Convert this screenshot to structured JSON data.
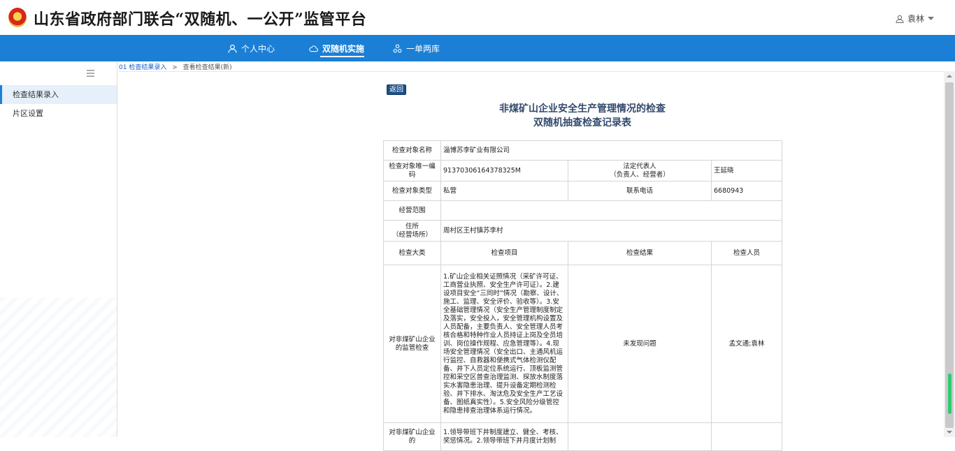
{
  "app": {
    "title": "山东省政府部门联合“双随机、一公开”监管平台",
    "user": "袁林"
  },
  "nav": {
    "items": [
      {
        "label": "个人中心",
        "icon": "user-icon"
      },
      {
        "label": "双随机实施",
        "icon": "cloud-icon",
        "active": true
      },
      {
        "label": "一单两库",
        "icon": "cluster-icon"
      }
    ]
  },
  "sidebar": {
    "items": [
      {
        "label": "检查结果录入",
        "active": true
      },
      {
        "label": "片区设置"
      }
    ]
  },
  "breadcrumb": {
    "link": "01 检查结果录入",
    "sep": ">",
    "current": "查看检查结果(新)"
  },
  "page": {
    "back_label": "返回",
    "title_line1": "非煤矿山企业安全生产管理情况的检查",
    "title_line2": "双随机抽查检查记录表"
  },
  "record": {
    "name_label": "检查对象名称",
    "name_value": "淄博苏李矿业有限公司",
    "code_label": "检查对象唯一编码",
    "code_value": "91370306164378325M",
    "legal_label_1": "法定代表人",
    "legal_label_2": "（负责人、经营者）",
    "legal_value": "王延晓",
    "type_label": "检查对象类型",
    "type_value": "私营",
    "phone_label": "联系电话",
    "phone_value": "6680943",
    "scope_label": "经营范围",
    "scope_value": "",
    "addr_label_1": "住所",
    "addr_label_2": "（经营场所）",
    "addr_value": "周村区王村镇苏李村"
  },
  "table": {
    "headers": [
      "检查大类",
      "检查项目",
      "检查结果",
      "检查人员"
    ],
    "rows": [
      {
        "category": "对非煤矿山企业的监管检查",
        "items": "1.矿山企业相关证照情况（采矿许可证、工商营业执照、安全生产许可证）。2.建设项目安全“三同时”情况（勘察、设计、施工、监理、安全评价、验收等）。3.安全基础管理情况（安全生产管理制度制定及落实，安全投入，安全管理机构设置及人员配备，主要负责人、安全管理人员考核合格和特种作业人员持证上岗及全员培训、岗位操作规程、应急管理等）。4.现场安全管理情况（安全出口、主通风机运行监控、自救器和便携式气体检测仪配备、井下人员定位系统运行、顶板监测管控和采空区普查治理监测、探放水制度落实水害隐患治理、提升设备定期检测检验、井下排水、淘汰危及安全生产工艺设备、图纸真实性）。5.安全风险分级管控和隐患排查治理体系运行情况。",
        "result": "未发现问题",
        "inspectors": "孟文通;袁林"
      },
      {
        "category": "对非煤矿山企业的",
        "items": "1.领导带班下井制度建立、健全、考核、奖惩情况。2.领导带班下井月度计划制",
        "result": "",
        "inspectors": ""
      }
    ]
  }
}
